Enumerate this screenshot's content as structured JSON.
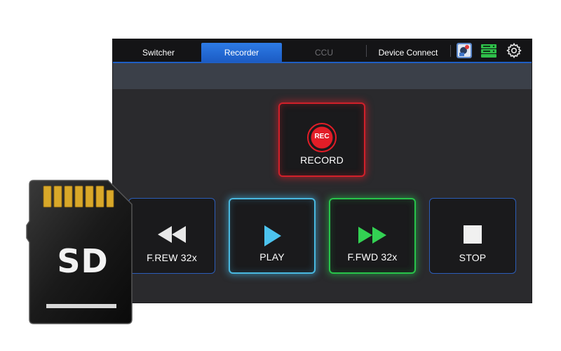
{
  "tabs": [
    {
      "label": "Switcher",
      "state": "normal"
    },
    {
      "label": "Recorder",
      "state": "active"
    },
    {
      "label": "CCU",
      "state": "disabled"
    },
    {
      "label": "Device Connect",
      "state": "normal"
    }
  ],
  "toolbar_icons": [
    "camera-app-icon",
    "storage-icon",
    "gear-icon"
  ],
  "transport": {
    "record": {
      "badge": "REC",
      "label": "RECORD"
    },
    "rewind": {
      "label": "F.REW 32x"
    },
    "play": {
      "label": "PLAY"
    },
    "forward": {
      "label": "F.FWD 32x"
    },
    "stop": {
      "label": "STOP"
    }
  },
  "sd_card": {
    "text": "SD"
  },
  "colors": {
    "accent_blue": "#1f5fc4",
    "record_red": "#d1202a",
    "play_cyan": "#49b8e0",
    "forward_green": "#28c44a",
    "panel_bg": "#2a2a2d"
  }
}
